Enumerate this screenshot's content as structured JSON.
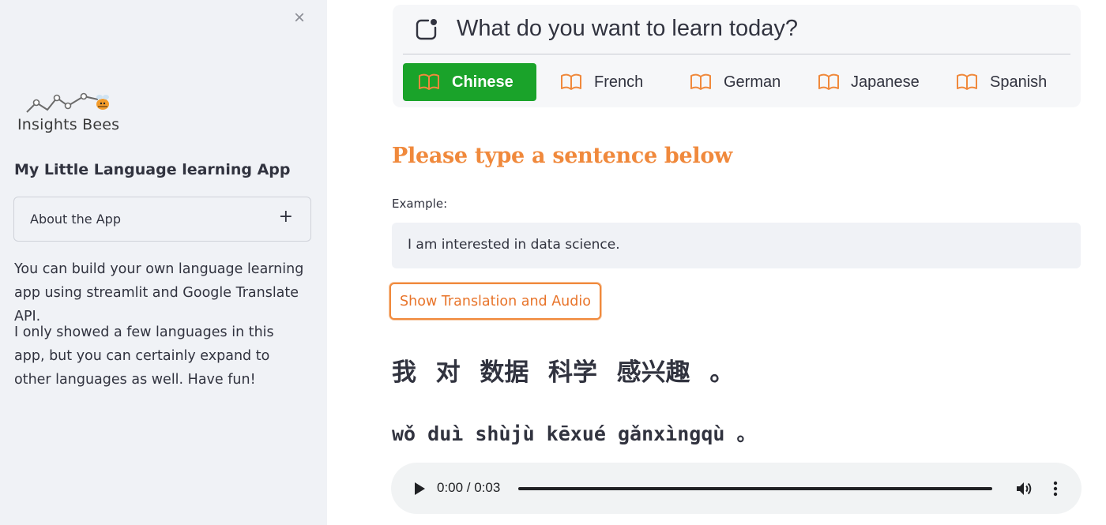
{
  "sidebar": {
    "close_glyph": "×",
    "logo_text": "Insights Bees",
    "app_title": "My Little Language learning App",
    "expander": {
      "label": "About the App",
      "toggle_glyph": "+"
    },
    "paragraphs": [
      "You can build your own language learning app using streamlit and Google Translate API.",
      "I only showed a few languages in this app, but you can certainly expand to other languages as well. Have fun!"
    ]
  },
  "menu": {
    "prompt": "What do you want to learn today?",
    "prompt_icon": "chat-bubble-icon",
    "selected": "Chinese",
    "tab_icon": "book-icon",
    "tabs": [
      {
        "label": "Chinese"
      },
      {
        "label": "French"
      },
      {
        "label": "German"
      },
      {
        "label": "Japanese"
      },
      {
        "label": "Spanish"
      }
    ]
  },
  "main": {
    "heading": "Please type a sentence below",
    "example_label": "Example:",
    "example_sentence": "I am interested in data science.",
    "button_label": "Show Translation and Audio",
    "translation": "我 对 数据 科学 感兴趣 。",
    "pinyin": "wǒ duì shùjù kēxué gǎnxìngqù 。"
  },
  "audio": {
    "time": "0:00 / 0:03",
    "progress": 0,
    "play_icon": "play-icon",
    "volume_icon": "volume-icon",
    "more_icon": "more-vert-icon"
  },
  "colors": {
    "accent_orange": "#f0893c",
    "active_tab_green": "#1aa32a",
    "sidebar_bg": "#f0f2f6"
  }
}
